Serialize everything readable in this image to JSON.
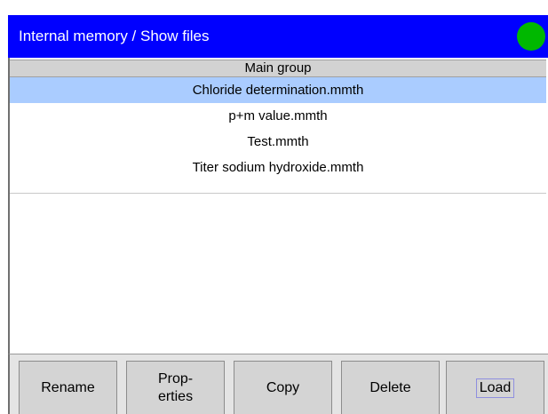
{
  "window": {
    "title": "Internal memory / Show files",
    "status_color": "#00b800",
    "title_bar_color": "#0000ff"
  },
  "list": {
    "group_header": "Main group",
    "files": [
      {
        "name": "Chloride determination.mmth",
        "selected": true
      },
      {
        "name": "p+m value.mmth",
        "selected": false
      },
      {
        "name": "Test.mmth",
        "selected": false
      },
      {
        "name": "Titer sodium hydroxide.mmth",
        "selected": false
      }
    ],
    "selection_color": "#aaccff"
  },
  "buttons": {
    "rename": "Rename",
    "properties": "Prop-\nerties",
    "copy": "Copy",
    "delete": "Delete",
    "load": "Load"
  }
}
